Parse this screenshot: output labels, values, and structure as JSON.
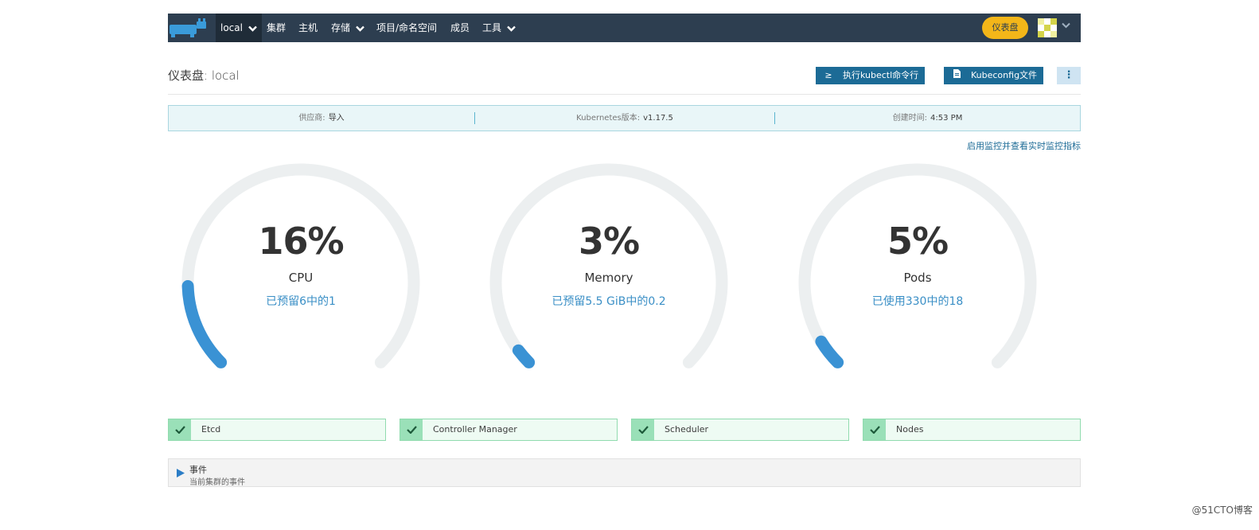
{
  "nav": {
    "cluster_selector": "local",
    "items": [
      "集群",
      "主机",
      "存储",
      "项目/命名空间",
      "成员",
      "工具"
    ],
    "dashboard_button": "仪表盘"
  },
  "header": {
    "title": "仪表盘: local",
    "kubectl_button": "执行kubectl命令行",
    "kubeconfig_button": "Kubeconfig文件",
    "more_button": "⋮"
  },
  "info": {
    "provider_label": "供应商:",
    "provider_value": "导入",
    "k8s_label": "Kubernetes版本:",
    "k8s_value": "v1.17.5",
    "created_label": "创建时间:",
    "created_value": "4:53 PM"
  },
  "monitoring_link": "启用监控并查看实时监控指标",
  "gauges": [
    {
      "percent_text": "16%",
      "label": "CPU",
      "sub": "已预留6中的1",
      "fill": 0.16
    },
    {
      "percent_text": "3%",
      "label": "Memory",
      "sub": "已预留5.5 GiB中的0.2",
      "fill": 0.03
    },
    {
      "percent_text": "5%",
      "label": "Pods",
      "sub": "已使用330中的18",
      "fill": 0.05
    }
  ],
  "components": [
    "Etcd",
    "Controller Manager",
    "Scheduler",
    "Nodes"
  ],
  "events": {
    "title": "事件",
    "subtitle": "当前集群的事件"
  },
  "watermark": "@51CTO博客",
  "colors": {
    "nav_bg": "#2d3e50",
    "accent_yellow": "#f3b619",
    "gauge_fill": "#3a92d4",
    "gauge_track": "#eceff0",
    "ok_green": "#9ae0b8"
  }
}
